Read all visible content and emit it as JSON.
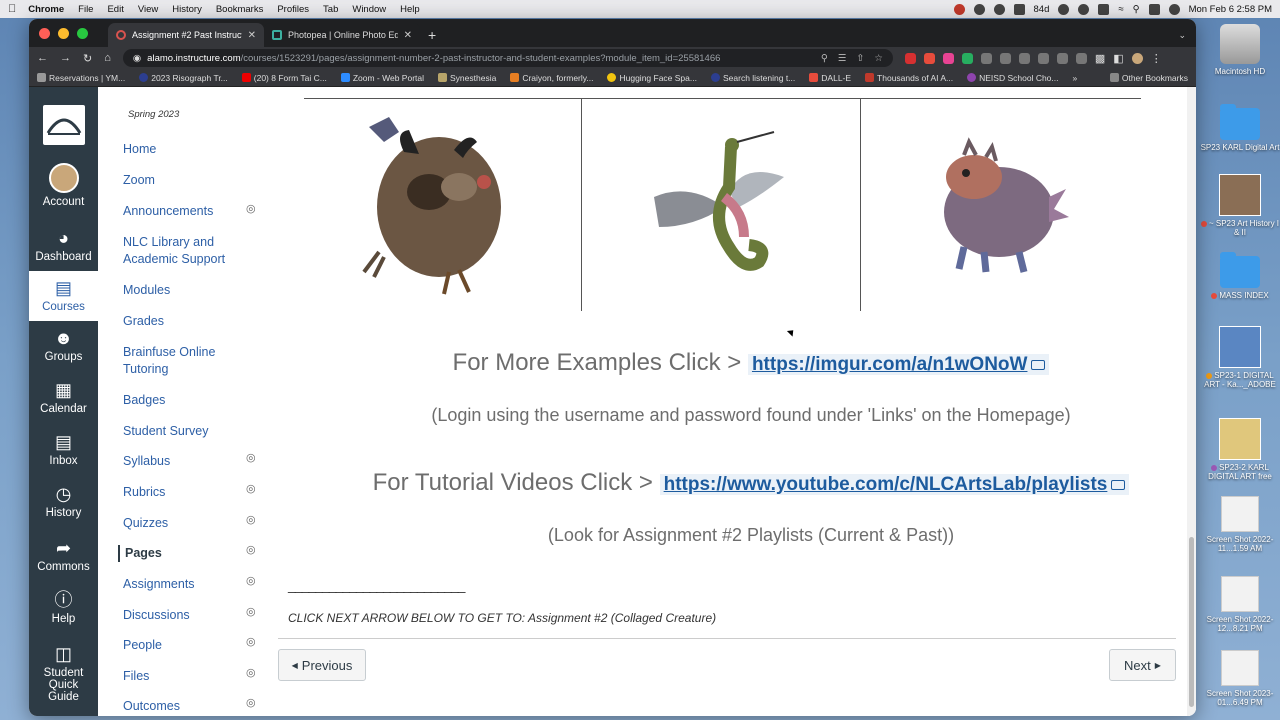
{
  "menubar": {
    "app": "Chrome",
    "items": [
      "File",
      "Edit",
      "View",
      "History",
      "Bookmarks",
      "Profiles",
      "Tab",
      "Window",
      "Help"
    ],
    "battery_text": "84d",
    "datetime": "Mon Feb 6  2:58 PM"
  },
  "browser": {
    "tabs": [
      {
        "title": "Assignment #2 Past Instructor",
        "active": true
      },
      {
        "title": "Photopea | Online Photo Editor",
        "active": false
      }
    ],
    "url_host": "alamo.instructure.com",
    "url_path": "/courses/1523291/pages/assignment-number-2-past-instructor-and-student-examples?module_item_id=25581466",
    "bookmarks": [
      "Reservations | YM...",
      "2023 Risograph Tr...",
      "(20) 8 Form Tai C...",
      "Zoom - Web Portal",
      "Synesthesia",
      "Craiyon, formerly...",
      "Hugging Face Spa...",
      "Search listening t...",
      "DALL-E",
      "Thousands of AI A...",
      "NEISD School Cho..."
    ],
    "bookmarks_more": "»",
    "other_bookmarks": "Other Bookmarks"
  },
  "global_nav": {
    "items": [
      {
        "label": "Account",
        "icon": "avatar"
      },
      {
        "label": "Dashboard",
        "icon": "dashboard-icon"
      },
      {
        "label": "Courses",
        "icon": "courses-icon",
        "active": true
      },
      {
        "label": "Groups",
        "icon": "groups-icon"
      },
      {
        "label": "Calendar",
        "icon": "calendar-icon"
      },
      {
        "label": "Inbox",
        "icon": "inbox-icon"
      },
      {
        "label": "History",
        "icon": "history-icon"
      },
      {
        "label": "Commons",
        "icon": "commons-icon"
      },
      {
        "label": "Help",
        "icon": "help-icon"
      },
      {
        "label": "Student Quick Guide",
        "icon": "guide-icon"
      }
    ]
  },
  "course_nav": {
    "term": "Spring 2023",
    "items": [
      {
        "label": "Home",
        "hidden": false
      },
      {
        "label": "Zoom",
        "hidden": false
      },
      {
        "label": "Announcements",
        "hidden": true
      },
      {
        "label": "NLC Library and Academic Support",
        "hidden": false
      },
      {
        "label": "Modules",
        "hidden": false
      },
      {
        "label": "Grades",
        "hidden": false
      },
      {
        "label": "Brainfuse Online Tutoring",
        "hidden": false
      },
      {
        "label": "Badges",
        "hidden": false
      },
      {
        "label": "Student Survey",
        "hidden": false
      },
      {
        "label": "Syllabus",
        "hidden": true
      },
      {
        "label": "Rubrics",
        "hidden": true
      },
      {
        "label": "Quizzes",
        "hidden": true
      },
      {
        "label": "Pages",
        "hidden": true,
        "active": true
      },
      {
        "label": "Assignments",
        "hidden": true
      },
      {
        "label": "Discussions",
        "hidden": true
      },
      {
        "label": "People",
        "hidden": true
      },
      {
        "label": "Files",
        "hidden": true
      },
      {
        "label": "Outcomes",
        "hidden": true
      }
    ]
  },
  "content": {
    "examples_label": "For More Examples Click >",
    "examples_link": "https://imgur.com/a/n1wONoW",
    "examples_note": "(Login using the username and password found under 'Links' on the Homepage)",
    "tutorials_label": "For Tutorial Videos Click >",
    "tutorials_link": "https://www.youtube.com/c/NLCArtsLab/playlists",
    "tutorials_note": "(Look for Assignment #2 Playlists (Current & Past))",
    "rule": "__________________________",
    "next_hint": "CLICK NEXT ARROW BELOW TO GET TO: Assignment #2 (Collaged Creature)",
    "previous_label": "Previous",
    "next_label": "Next"
  },
  "desktop_icons": [
    {
      "label": "Macintosh HD"
    },
    {
      "label": "SP23 KARL Digital Art"
    },
    {
      "label": "~ SP23 Art History I & II"
    },
    {
      "label": "MASS INDEX"
    },
    {
      "label": "SP23-1 DIGITAL ART - Ka..._ADOBE"
    },
    {
      "label": "SP23-2 KARL DIGITAL ART  free"
    },
    {
      "label": "Screen Shot 2022-11...1.59 AM"
    },
    {
      "label": "Screen Shot 2022-12...8.21 PM"
    },
    {
      "label": "Screen Shot 2023-01...6.49 PM"
    }
  ],
  "colors": {
    "canvas_nav": "#2d3b45",
    "link": "#1d5b9e",
    "course_link": "#2d5fa6"
  }
}
